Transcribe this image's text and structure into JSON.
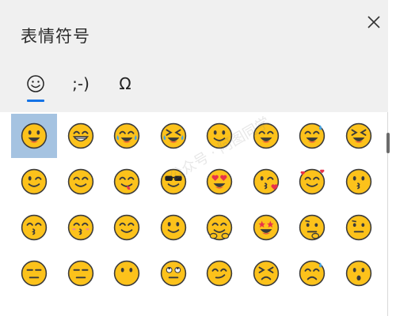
{
  "window": {
    "title": "表情符号",
    "close_icon": "close-icon"
  },
  "tabs": [
    {
      "name": "smiley",
      "icon": "smiley-face-icon",
      "selected": true
    },
    {
      "name": "kaomoji",
      "label": ";-)",
      "selected": false
    },
    {
      "name": "symbols",
      "label": "Ω",
      "selected": false
    }
  ],
  "colors": {
    "accent": "#1473e6",
    "selection": "#a5c3e1",
    "emoji_face": "#fcc21b"
  },
  "emoji_rows": [
    [
      "grinning-face",
      "grinning-face-with-big-eyes",
      "tears-of-joy",
      "rolling-laughing",
      "smiling-face",
      "beaming-face",
      "sweat-smile",
      "squinting-face"
    ],
    [
      "winking-face",
      "smiling-eyes",
      "yum-face",
      "sunglasses-face",
      "heart-eyes",
      "kissing-heart",
      "smiling-with-hearts",
      "kissing-face"
    ],
    [
      "kissing-smiling-eyes",
      "kissing-closed-eyes",
      "relieved-face",
      "slightly-smiling",
      "hugging-face",
      "star-struck",
      "thinking-face",
      "raised-eyebrow"
    ],
    [
      "neutral-face",
      "expressionless-face",
      "no-mouth-face",
      "eye-roll",
      "smirking-face",
      "persevering-face",
      "disappointed-relieved",
      "hushed-face"
    ]
  ],
  "selected_emoji": "grinning-face",
  "watermark": "公众号 · 阿图同学"
}
